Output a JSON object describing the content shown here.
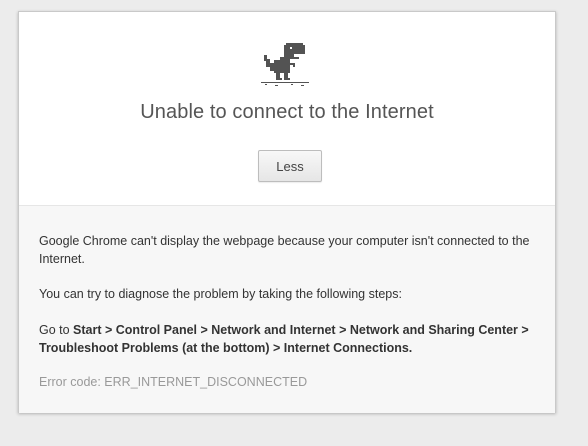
{
  "dialog": {
    "title": "Unable to connect to the Internet",
    "button_label": "Less",
    "icon": "offline-dino-icon",
    "message": "Google Chrome can't display the webpage because your computer isn't connected to the Internet.",
    "diagnose_intro": "You can try to diagnose the problem by taking the following steps:",
    "steps_prefix": "Go to ",
    "steps_path": "Start > Control Panel > Network and Internet > Network and Sharing Center > Troubleshoot Problems (at the bottom) > Internet Connections.",
    "error_code": "Error code: ERR_INTERNET_DISCONNECTED"
  }
}
